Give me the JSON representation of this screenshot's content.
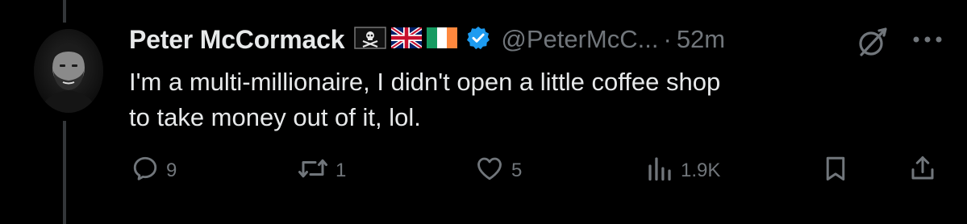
{
  "tweet": {
    "author_name": "Peter McCormack",
    "handle": "@PeterMcC...",
    "separator": "·",
    "time": "52m",
    "badges": [
      "pirate-flag-icon",
      "uk-flag-icon",
      "ireland-flag-icon",
      "verified-badge-icon"
    ],
    "text": "I'm a multi-millionaire, I didn't open a little coffee shop\nto take money out of it, lol."
  },
  "actions": {
    "replies": "9",
    "reposts": "1",
    "likes": "5",
    "views": "1.9K"
  },
  "colors": {
    "background": "#000000",
    "text_primary": "#e7e9ea",
    "text_secondary": "#71767b",
    "verified": "#1d9bf0",
    "thread_line": "#333639"
  }
}
